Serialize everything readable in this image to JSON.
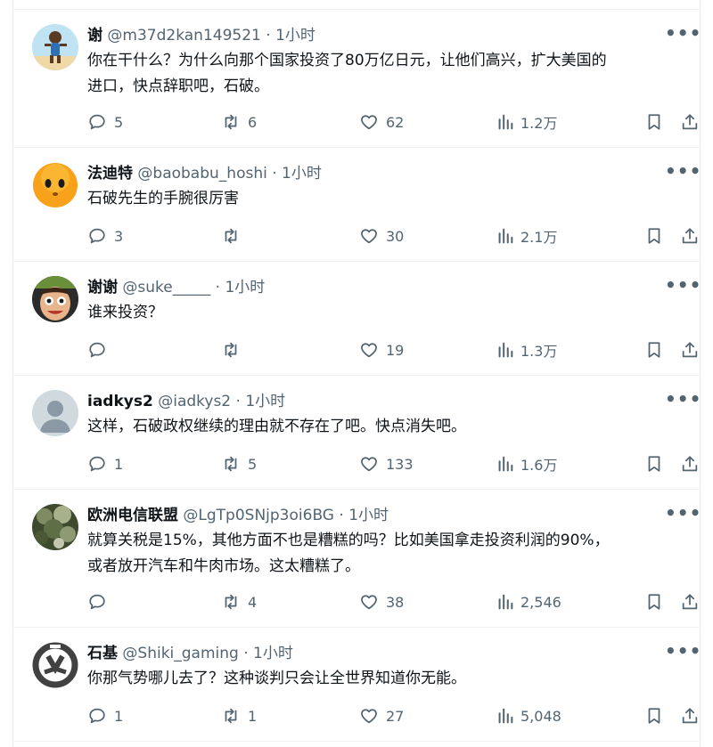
{
  "tweets": [
    {
      "name": "谢",
      "handle": "@m37d2kan149521",
      "sep": " · ",
      "time": "1小时",
      "lines": [
        "你在干什么？为什么向那个国家投资了80万亿日元，让他们高兴，扩大美国的",
        "进口，快点辞职吧，石破。"
      ],
      "replies": "5",
      "retweets": "6",
      "likes": "62",
      "views": "1.2万",
      "avatar": "cartoon-character-avatar"
    },
    {
      "name": "法迪特",
      "handle": "@baobabu_hoshi",
      "sep": " · ",
      "time": "1小时",
      "lines": [
        "石破先生的手腕很厉害"
      ],
      "replies": "3",
      "retweets": "",
      "likes": "30",
      "views": "2.1万",
      "avatar": "orange-face-avatar"
    },
    {
      "name": "谢谢",
      "handle": "@suke_____",
      "sep": " · ",
      "time": "1小时",
      "lines": [
        "谁来投资？"
      ],
      "replies": "",
      "retweets": "",
      "likes": "19",
      "views": "1.3万",
      "avatar": "cartoon-face-avatar"
    },
    {
      "name": "iadkys2",
      "handle": "@iadkys2",
      "sep": " · ",
      "time": "1小时",
      "lines": [
        "这样，石破政权继续的理由就不存在了吧。快点消失吧。"
      ],
      "replies": "1",
      "retweets": "5",
      "likes": "133",
      "views": "1.6万",
      "avatar": "default-avatar"
    },
    {
      "name": "欧洲电信联盟",
      "handle": "@LgTp0SNjp3oi6BG",
      "sep": " · ",
      "time": "1小时",
      "lines": [
        "就算关税是15%，其他方面不也是糟糕的吗？比如美国拿走投资利润的90%，",
        "或者放开汽车和牛肉市场。这太糟糕了。"
      ],
      "replies": "",
      "retweets": "4",
      "likes": "38",
      "views": "2,546",
      "avatar": "tree-photo-avatar"
    },
    {
      "name": "石基",
      "handle": "@Shiki_gaming",
      "sep": " · ",
      "time": "1小时",
      "lines": [
        "你那气势哪儿去了？这种谈判只会让全世界知道你无能。"
      ],
      "replies": "1",
      "retweets": "1",
      "likes": "27",
      "views": "5,048",
      "avatar": "overwatch-logo-avatar"
    }
  ],
  "ui": {
    "more": "•••"
  },
  "colors": {
    "text": "#0f1419",
    "secondary": "#536471",
    "divider": "#eff3f4"
  }
}
